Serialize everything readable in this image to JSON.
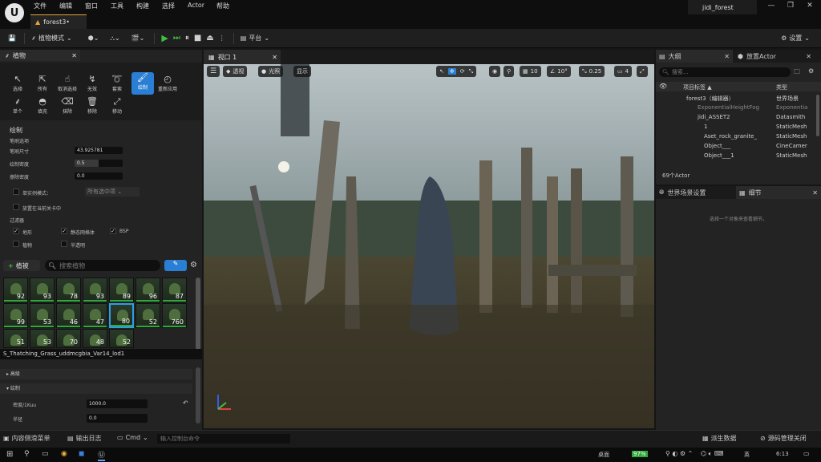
{
  "menu": [
    "文件",
    "编辑",
    "窗口",
    "工具",
    "构建",
    "选择",
    "Actor",
    "帮助"
  ],
  "doc_tab": "forest3•",
  "project_name": "jidi_forest",
  "toolbar": {
    "mode_label": "植物模式",
    "platform_label": "平台",
    "settings_label": "设置"
  },
  "foliage_panel": {
    "tab_title": "植物",
    "tools_row1": [
      "选择",
      "所有",
      "取消选择",
      "无效",
      "套索",
      "绘制",
      "重新应用"
    ],
    "tools_row2": [
      "单个",
      "填充",
      "抹除",
      "移除",
      "移动"
    ],
    "section_paint": "绘制",
    "brush_options_header": "笔刷选项",
    "brush_size_label": "笔刷尺寸",
    "brush_size_value": "43.925781",
    "paint_density_label": "绘制密度",
    "paint_density_value": "0.5",
    "erase_density_label": "擦除密度",
    "erase_density_value": "0.0",
    "single_instance_label": "单实例模式：",
    "single_instance_value": "所有选中项",
    "current_level_label": "放置在当前关卡中",
    "filter_header": "过滤器",
    "filters": [
      {
        "label": "地形",
        "checked": true
      },
      {
        "label": "静态网格体",
        "checked": true
      },
      {
        "label": "BSP",
        "checked": true
      },
      {
        "label": "植物",
        "checked": false
      },
      {
        "label": "半透明",
        "checked": false
      }
    ],
    "add_foliage_label": "植被",
    "search_placeholder": "搜索植物",
    "thumb_counts_row1": [
      "92",
      "93",
      "78",
      "93",
      "89",
      "96",
      "87"
    ],
    "thumb_counts_row2": [
      "99",
      "53",
      "46",
      "47",
      "80",
      "52",
      "760"
    ],
    "thumb_counts_row3": [
      "51",
      "53",
      "70",
      "48",
      "52"
    ],
    "selected_asset": "S_Thatching_Grass_uddmcgbia_Var14_lod1",
    "section_advanced": "高级",
    "section_paint2": "绘制",
    "density_label": "密度/1Kuu",
    "density_value": "1000.0",
    "radius_label": "半径",
    "radius_value": "0.0"
  },
  "viewport": {
    "tab_title": "视口 1",
    "perspective": "透视",
    "lit": "光照",
    "show": "显示",
    "grid_snap": "10",
    "rot_snap": "10°",
    "scale_snap": "0.25",
    "cam_speed": "4"
  },
  "outliner": {
    "tab_title": "大纲",
    "place_actor_tab": "放置Actor",
    "search_placeholder": "搜索...",
    "col_label": "项目标签 ▲",
    "col_type": "类型",
    "rows": [
      {
        "label": "forest3（编辑器）",
        "type": "世界场景"
      },
      {
        "label": "ExponentialHeightFog",
        "type": "Exponentia"
      },
      {
        "label": "jidi_ASSET2",
        "type": "Datasmith"
      },
      {
        "label": "1",
        "type": "StaticMesh"
      },
      {
        "label": "Aset_rock_granite_",
        "type": "StaticMesh"
      },
      {
        "label": "Object___",
        "type": "CineCamer"
      },
      {
        "label": "Object___1",
        "type": "StaticMesh"
      }
    ],
    "actor_count": "69个Actor"
  },
  "details": {
    "world_settings_tab": "世界场景设置",
    "details_tab": "细节",
    "empty_hint": "选择一个对象来查看细节。"
  },
  "statusbar": {
    "content_drawer": "内容侧滑菜单",
    "output_log": "输出日志",
    "cmd": "Cmd",
    "cmd_placeholder": "输入控制台命令",
    "derived_data": "派生数据",
    "source_control": "源码管理关闭"
  },
  "taskbar": {
    "desktop": "桌面",
    "battery": "97%",
    "ime": "英",
    "time": "6:13"
  }
}
